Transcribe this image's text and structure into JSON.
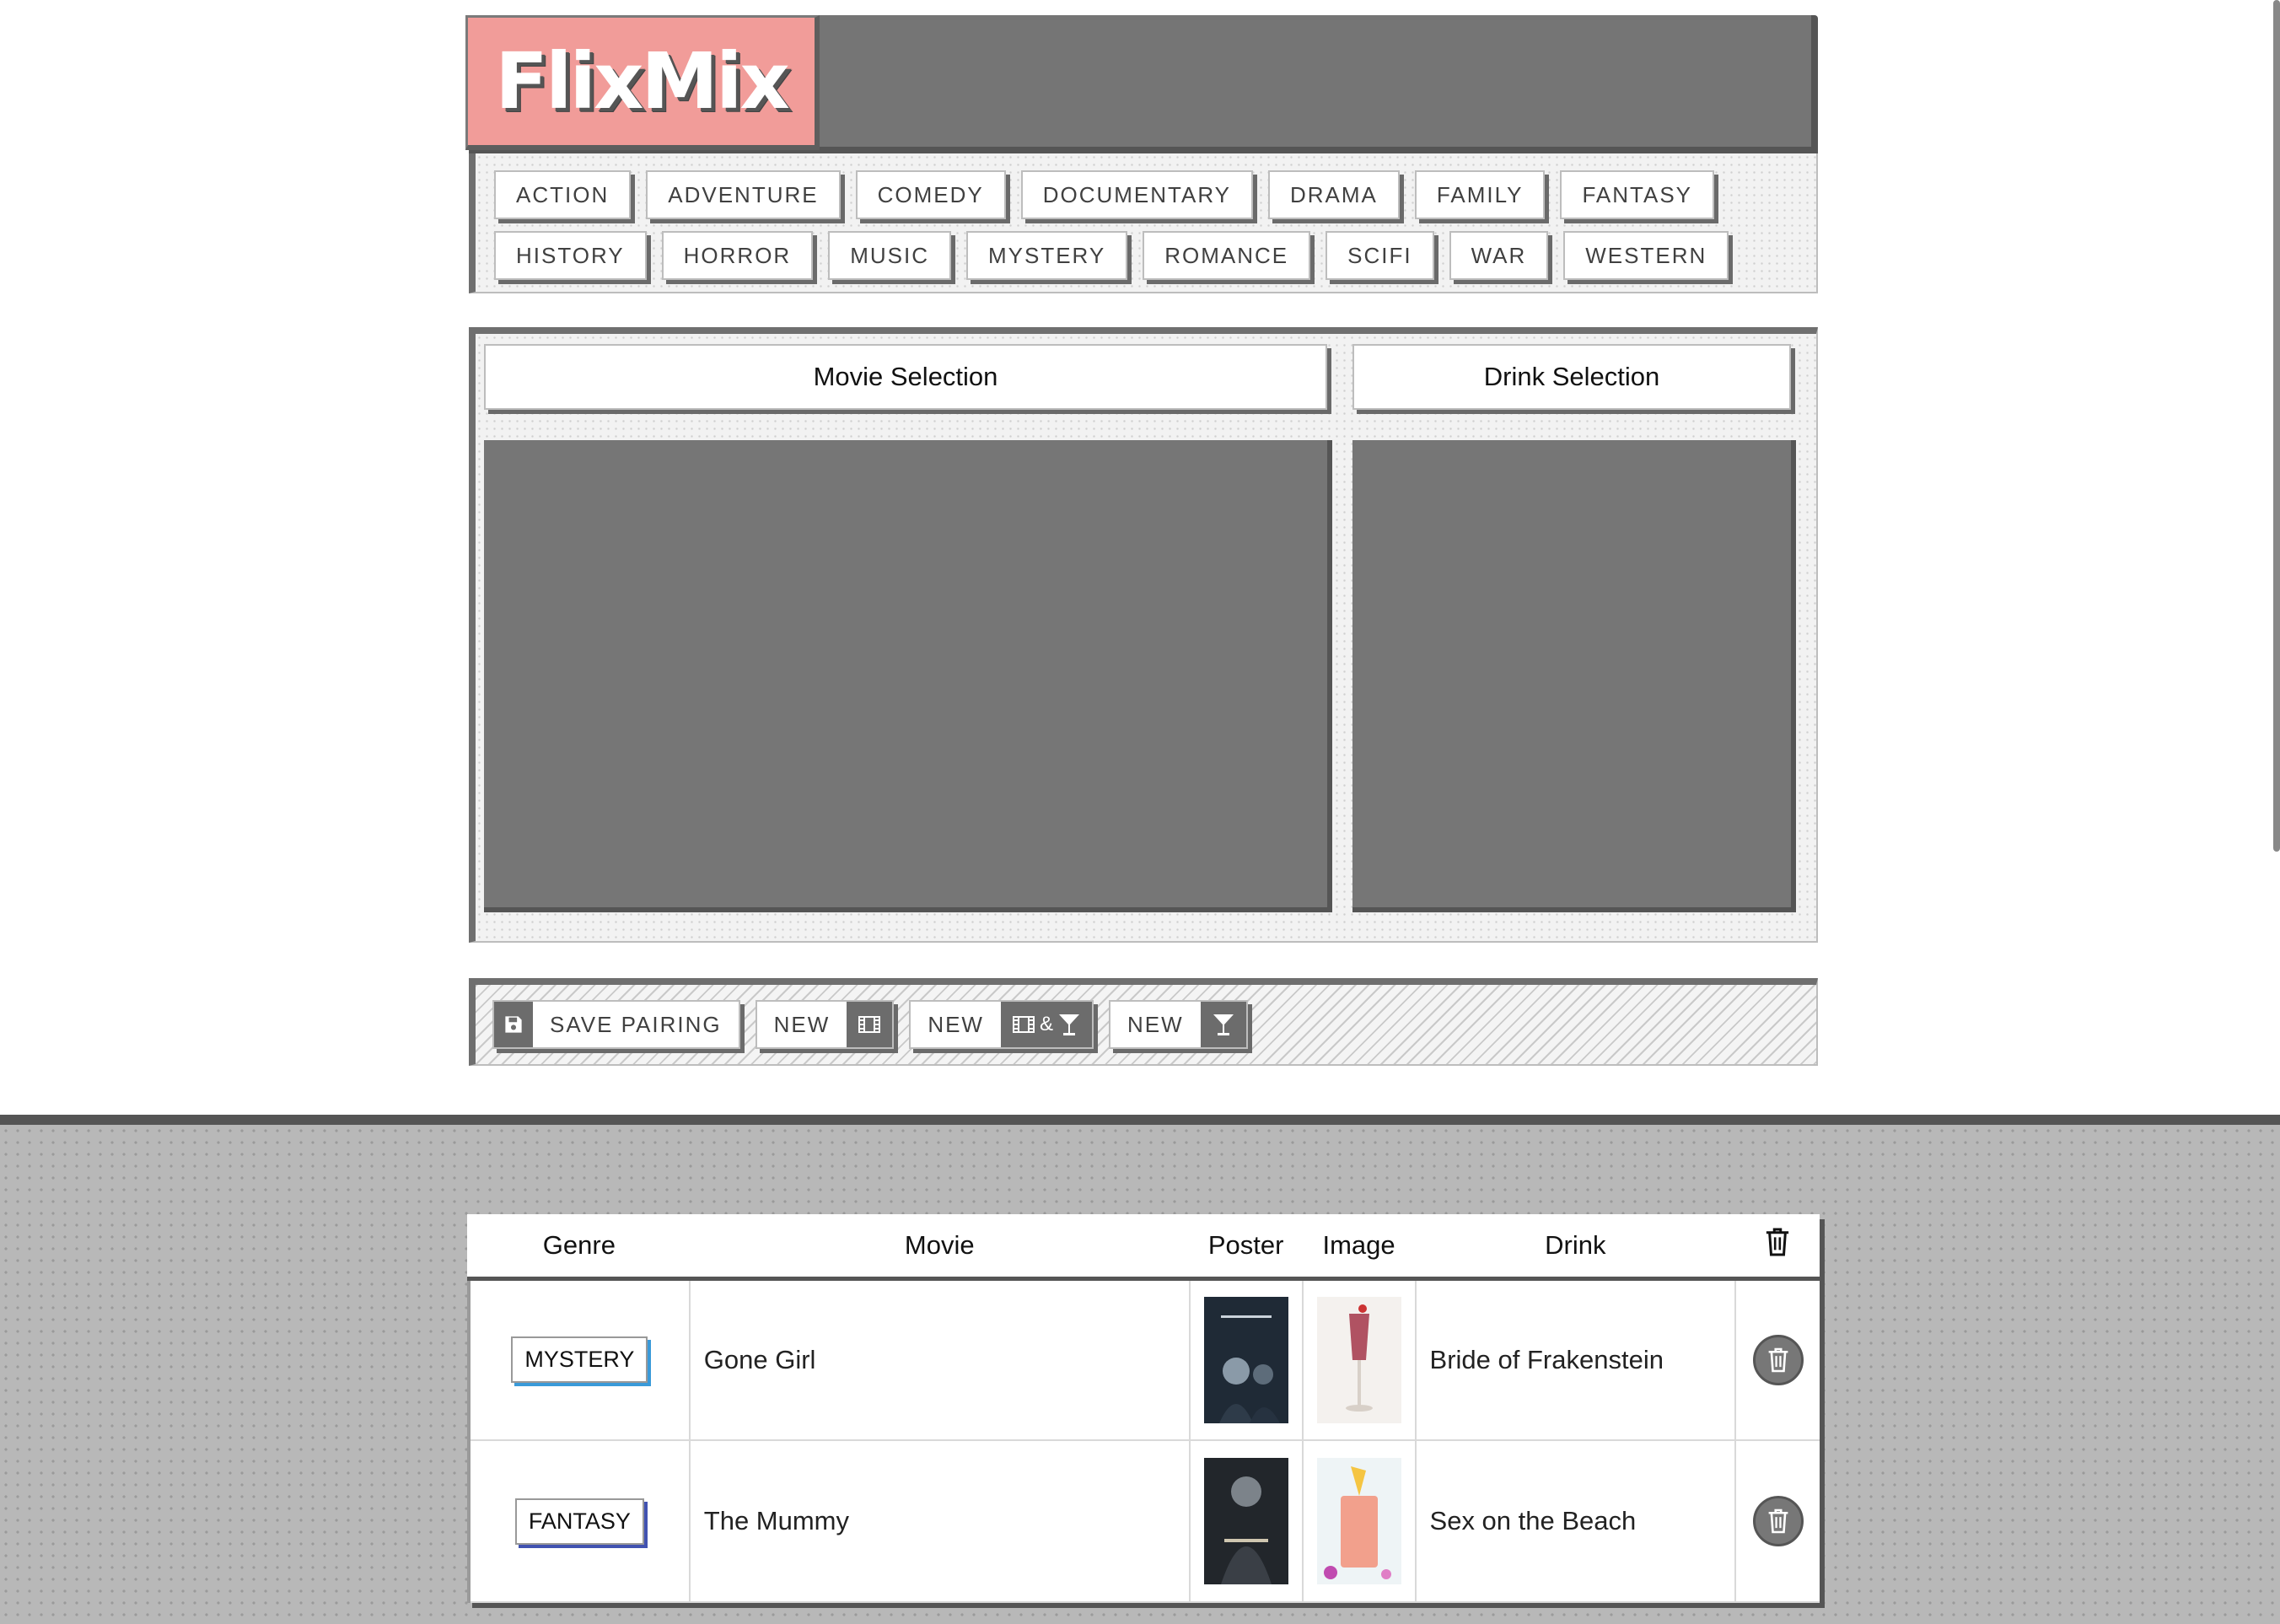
{
  "app": {
    "logo": "FlixMix"
  },
  "genres_row1": [
    "ACTION",
    "ADVENTURE",
    "COMEDY",
    "DOCUMENTARY",
    "DRAMA",
    "FAMILY",
    "FANTASY"
  ],
  "genres_row2": [
    "HISTORY",
    "HORROR",
    "MUSIC",
    "MYSTERY",
    "ROMANCE",
    "SCIFI",
    "WAR",
    "WESTERN"
  ],
  "selection": {
    "movie_title": "Movie Selection",
    "drink_title": "Drink Selection"
  },
  "actions": {
    "save_label": "SAVE PAIRING",
    "new_movie_label": "NEW",
    "new_both_label": "NEW",
    "new_both_amp": "&",
    "new_drink_label": "NEW"
  },
  "table": {
    "headers": {
      "genre": "Genre",
      "movie": "Movie",
      "poster": "Poster",
      "image": "Image",
      "drink": "Drink"
    },
    "rows": [
      {
        "genre": "MYSTERY",
        "movie": "Gone Girl",
        "drink": "Bride of Frakenstein"
      },
      {
        "genre": "FANTASY",
        "movie": "The Mummy",
        "drink": "Sex on the Beach"
      }
    ]
  },
  "colors": {
    "logo_bg": "#f19c99",
    "panel_gray": "#767676",
    "badge_mystery": "#3a9ad9",
    "badge_fantasy": "#4152b0"
  }
}
